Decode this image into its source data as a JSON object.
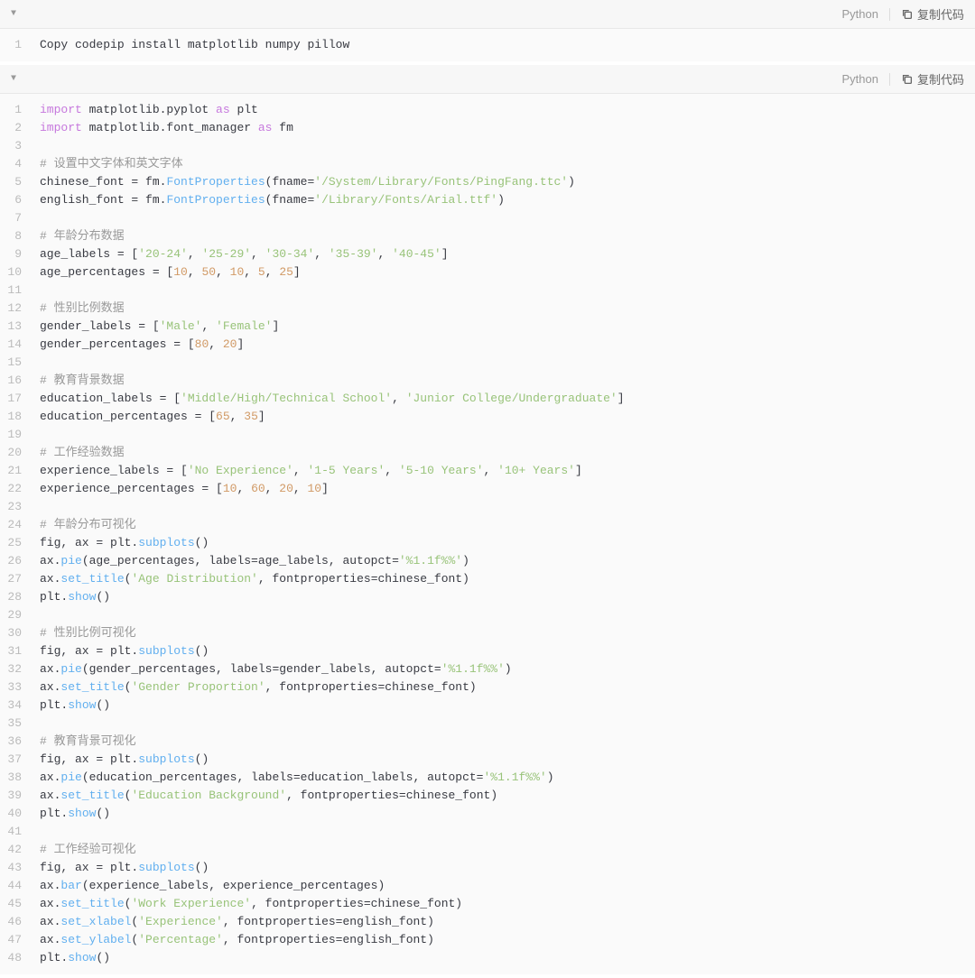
{
  "block1": {
    "language": "Python",
    "copy_label": "复制代码",
    "lines": [
      [
        {
          "t": "Copy codepip install matplotlib numpy pillow",
          "c": "id"
        }
      ]
    ]
  },
  "block2": {
    "language": "Python",
    "copy_label": "复制代码",
    "lines": [
      [
        {
          "t": "import",
          "c": "kw"
        },
        {
          "t": " matplotlib.pyplot ",
          "c": "id"
        },
        {
          "t": "as",
          "c": "kw"
        },
        {
          "t": " plt",
          "c": "id"
        }
      ],
      [
        {
          "t": "import",
          "c": "kw"
        },
        {
          "t": " matplotlib.font_manager ",
          "c": "id"
        },
        {
          "t": "as",
          "c": "kw"
        },
        {
          "t": " fm",
          "c": "id"
        }
      ],
      [],
      [
        {
          "t": "# 设置中文字体和英文字体",
          "c": "cmt"
        }
      ],
      [
        {
          "t": "chinese_font = fm.",
          "c": "id"
        },
        {
          "t": "FontProperties",
          "c": "fn"
        },
        {
          "t": "(fname=",
          "c": "id"
        },
        {
          "t": "'/System/Library/Fonts/PingFang.ttc'",
          "c": "str"
        },
        {
          "t": ")",
          "c": "id"
        }
      ],
      [
        {
          "t": "english_font = fm.",
          "c": "id"
        },
        {
          "t": "FontProperties",
          "c": "fn"
        },
        {
          "t": "(fname=",
          "c": "id"
        },
        {
          "t": "'/Library/Fonts/Arial.ttf'",
          "c": "str"
        },
        {
          "t": ")",
          "c": "id"
        }
      ],
      [],
      [
        {
          "t": "# 年龄分布数据",
          "c": "cmt"
        }
      ],
      [
        {
          "t": "age_labels = [",
          "c": "id"
        },
        {
          "t": "'20-24'",
          "c": "str"
        },
        {
          "t": ", ",
          "c": "id"
        },
        {
          "t": "'25-29'",
          "c": "str"
        },
        {
          "t": ", ",
          "c": "id"
        },
        {
          "t": "'30-34'",
          "c": "str"
        },
        {
          "t": ", ",
          "c": "id"
        },
        {
          "t": "'35-39'",
          "c": "str"
        },
        {
          "t": ", ",
          "c": "id"
        },
        {
          "t": "'40-45'",
          "c": "str"
        },
        {
          "t": "]",
          "c": "id"
        }
      ],
      [
        {
          "t": "age_percentages = [",
          "c": "id"
        },
        {
          "t": "10",
          "c": "num"
        },
        {
          "t": ", ",
          "c": "id"
        },
        {
          "t": "50",
          "c": "num"
        },
        {
          "t": ", ",
          "c": "id"
        },
        {
          "t": "10",
          "c": "num"
        },
        {
          "t": ", ",
          "c": "id"
        },
        {
          "t": "5",
          "c": "num"
        },
        {
          "t": ", ",
          "c": "id"
        },
        {
          "t": "25",
          "c": "num"
        },
        {
          "t": "]",
          "c": "id"
        }
      ],
      [],
      [
        {
          "t": "# 性别比例数据",
          "c": "cmt"
        }
      ],
      [
        {
          "t": "gender_labels = [",
          "c": "id"
        },
        {
          "t": "'Male'",
          "c": "str"
        },
        {
          "t": ", ",
          "c": "id"
        },
        {
          "t": "'Female'",
          "c": "str"
        },
        {
          "t": "]",
          "c": "id"
        }
      ],
      [
        {
          "t": "gender_percentages = [",
          "c": "id"
        },
        {
          "t": "80",
          "c": "num"
        },
        {
          "t": ", ",
          "c": "id"
        },
        {
          "t": "20",
          "c": "num"
        },
        {
          "t": "]",
          "c": "id"
        }
      ],
      [],
      [
        {
          "t": "# 教育背景数据",
          "c": "cmt"
        }
      ],
      [
        {
          "t": "education_labels = [",
          "c": "id"
        },
        {
          "t": "'Middle/High/Technical School'",
          "c": "str"
        },
        {
          "t": ", ",
          "c": "id"
        },
        {
          "t": "'Junior College/Undergraduate'",
          "c": "str"
        },
        {
          "t": "]",
          "c": "id"
        }
      ],
      [
        {
          "t": "education_percentages = [",
          "c": "id"
        },
        {
          "t": "65",
          "c": "num"
        },
        {
          "t": ", ",
          "c": "id"
        },
        {
          "t": "35",
          "c": "num"
        },
        {
          "t": "]",
          "c": "id"
        }
      ],
      [],
      [
        {
          "t": "# 工作经验数据",
          "c": "cmt"
        }
      ],
      [
        {
          "t": "experience_labels = [",
          "c": "id"
        },
        {
          "t": "'No Experience'",
          "c": "str"
        },
        {
          "t": ", ",
          "c": "id"
        },
        {
          "t": "'1-5 Years'",
          "c": "str"
        },
        {
          "t": ", ",
          "c": "id"
        },
        {
          "t": "'5-10 Years'",
          "c": "str"
        },
        {
          "t": ", ",
          "c": "id"
        },
        {
          "t": "'10+ Years'",
          "c": "str"
        },
        {
          "t": "]",
          "c": "id"
        }
      ],
      [
        {
          "t": "experience_percentages = [",
          "c": "id"
        },
        {
          "t": "10",
          "c": "num"
        },
        {
          "t": ", ",
          "c": "id"
        },
        {
          "t": "60",
          "c": "num"
        },
        {
          "t": ", ",
          "c": "id"
        },
        {
          "t": "20",
          "c": "num"
        },
        {
          "t": ", ",
          "c": "id"
        },
        {
          "t": "10",
          "c": "num"
        },
        {
          "t": "]",
          "c": "id"
        }
      ],
      [],
      [
        {
          "t": "# 年龄分布可视化",
          "c": "cmt"
        }
      ],
      [
        {
          "t": "fig, ax = plt.",
          "c": "id"
        },
        {
          "t": "subplots",
          "c": "fn"
        },
        {
          "t": "()",
          "c": "id"
        }
      ],
      [
        {
          "t": "ax.",
          "c": "id"
        },
        {
          "t": "pie",
          "c": "fn"
        },
        {
          "t": "(age_percentages, labels=age_labels, autopct=",
          "c": "id"
        },
        {
          "t": "'%1.1f%%'",
          "c": "str"
        },
        {
          "t": ")",
          "c": "id"
        }
      ],
      [
        {
          "t": "ax.",
          "c": "id"
        },
        {
          "t": "set_title",
          "c": "fn"
        },
        {
          "t": "(",
          "c": "id"
        },
        {
          "t": "'Age Distribution'",
          "c": "str"
        },
        {
          "t": ", fontproperties=chinese_font)",
          "c": "id"
        }
      ],
      [
        {
          "t": "plt.",
          "c": "id"
        },
        {
          "t": "show",
          "c": "fn"
        },
        {
          "t": "()",
          "c": "id"
        }
      ],
      [],
      [
        {
          "t": "# 性别比例可视化",
          "c": "cmt"
        }
      ],
      [
        {
          "t": "fig, ax = plt.",
          "c": "id"
        },
        {
          "t": "subplots",
          "c": "fn"
        },
        {
          "t": "()",
          "c": "id"
        }
      ],
      [
        {
          "t": "ax.",
          "c": "id"
        },
        {
          "t": "pie",
          "c": "fn"
        },
        {
          "t": "(gender_percentages, labels=gender_labels, autopct=",
          "c": "id"
        },
        {
          "t": "'%1.1f%%'",
          "c": "str"
        },
        {
          "t": ")",
          "c": "id"
        }
      ],
      [
        {
          "t": "ax.",
          "c": "id"
        },
        {
          "t": "set_title",
          "c": "fn"
        },
        {
          "t": "(",
          "c": "id"
        },
        {
          "t": "'Gender Proportion'",
          "c": "str"
        },
        {
          "t": ", fontproperties=chinese_font)",
          "c": "id"
        }
      ],
      [
        {
          "t": "plt.",
          "c": "id"
        },
        {
          "t": "show",
          "c": "fn"
        },
        {
          "t": "()",
          "c": "id"
        }
      ],
      [],
      [
        {
          "t": "# 教育背景可视化",
          "c": "cmt"
        }
      ],
      [
        {
          "t": "fig, ax = plt.",
          "c": "id"
        },
        {
          "t": "subplots",
          "c": "fn"
        },
        {
          "t": "()",
          "c": "id"
        }
      ],
      [
        {
          "t": "ax.",
          "c": "id"
        },
        {
          "t": "pie",
          "c": "fn"
        },
        {
          "t": "(education_percentages, labels=education_labels, autopct=",
          "c": "id"
        },
        {
          "t": "'%1.1f%%'",
          "c": "str"
        },
        {
          "t": ")",
          "c": "id"
        }
      ],
      [
        {
          "t": "ax.",
          "c": "id"
        },
        {
          "t": "set_title",
          "c": "fn"
        },
        {
          "t": "(",
          "c": "id"
        },
        {
          "t": "'Education Background'",
          "c": "str"
        },
        {
          "t": ", fontproperties=chinese_font)",
          "c": "id"
        }
      ],
      [
        {
          "t": "plt.",
          "c": "id"
        },
        {
          "t": "show",
          "c": "fn"
        },
        {
          "t": "()",
          "c": "id"
        }
      ],
      [],
      [
        {
          "t": "# 工作经验可视化",
          "c": "cmt"
        }
      ],
      [
        {
          "t": "fig, ax = plt.",
          "c": "id"
        },
        {
          "t": "subplots",
          "c": "fn"
        },
        {
          "t": "()",
          "c": "id"
        }
      ],
      [
        {
          "t": "ax.",
          "c": "id"
        },
        {
          "t": "bar",
          "c": "fn"
        },
        {
          "t": "(experience_labels, experience_percentages)",
          "c": "id"
        }
      ],
      [
        {
          "t": "ax.",
          "c": "id"
        },
        {
          "t": "set_title",
          "c": "fn"
        },
        {
          "t": "(",
          "c": "id"
        },
        {
          "t": "'Work Experience'",
          "c": "str"
        },
        {
          "t": ", fontproperties=chinese_font)",
          "c": "id"
        }
      ],
      [
        {
          "t": "ax.",
          "c": "id"
        },
        {
          "t": "set_xlabel",
          "c": "fn"
        },
        {
          "t": "(",
          "c": "id"
        },
        {
          "t": "'Experience'",
          "c": "str"
        },
        {
          "t": ", fontproperties=english_font)",
          "c": "id"
        }
      ],
      [
        {
          "t": "ax.",
          "c": "id"
        },
        {
          "t": "set_ylabel",
          "c": "fn"
        },
        {
          "t": "(",
          "c": "id"
        },
        {
          "t": "'Percentage'",
          "c": "str"
        },
        {
          "t": ", fontproperties=english_font)",
          "c": "id"
        }
      ],
      [
        {
          "t": "plt.",
          "c": "id"
        },
        {
          "t": "show",
          "c": "fn"
        },
        {
          "t": "()",
          "c": "id"
        }
      ]
    ]
  }
}
